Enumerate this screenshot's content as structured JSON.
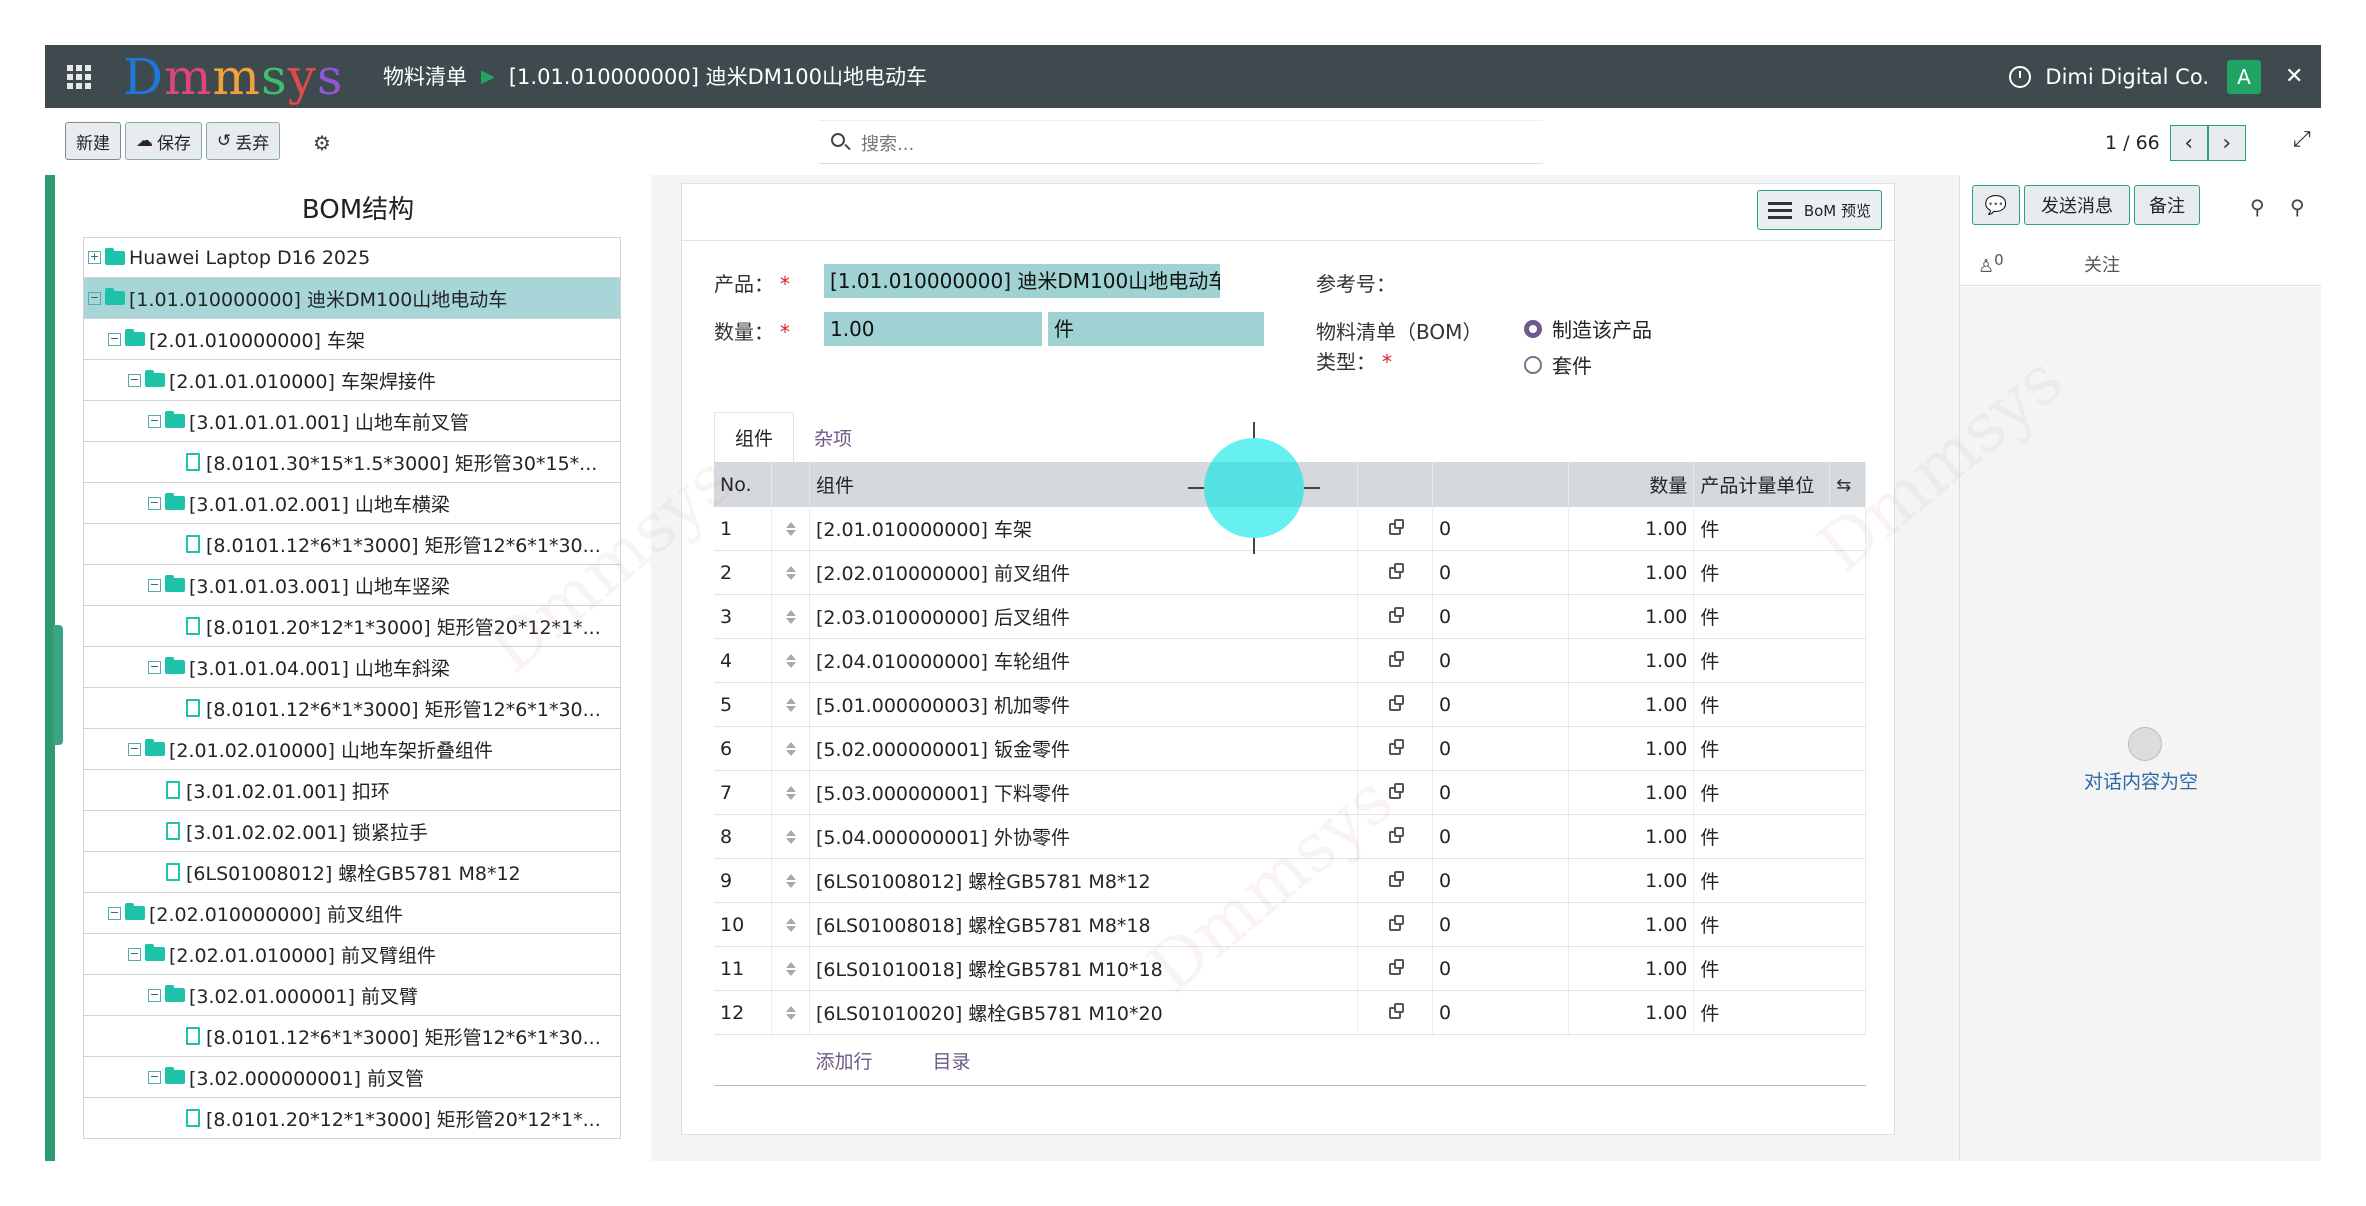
{
  "topbar": {
    "logo": "Dmmsys",
    "breadcrumb_root": "物料清单",
    "breadcrumb_current": "[1.01.010000000] 迪米DM100山地电动车",
    "company": "Dimi Digital Co.",
    "avatar_letter": "A"
  },
  "toolbar": {
    "new_label": "新建",
    "save_label": "保存",
    "discard_label": "丢弃",
    "search_placeholder": "搜索...",
    "pager": "1 / 66"
  },
  "tree": {
    "title": "BOM结构",
    "nodes": [
      {
        "label": "Huawei Laptop D16 2025",
        "level": 0,
        "kind": "folder",
        "toggle": "+",
        "selected": false
      },
      {
        "label": "[1.01.010000000] 迪米DM100山地电动车",
        "level": 0,
        "kind": "folder",
        "toggle": "-",
        "selected": true
      },
      {
        "label": "[2.01.010000000] 车架",
        "level": 1,
        "kind": "folder",
        "toggle": "-",
        "selected": false
      },
      {
        "label": "[2.01.01.010000] 车架焊接件",
        "level": 2,
        "kind": "folder",
        "toggle": "-",
        "selected": false
      },
      {
        "label": "[3.01.01.01.001] 山地车前叉管",
        "level": 3,
        "kind": "folder",
        "toggle": "-",
        "selected": false
      },
      {
        "label": "[8.0101.30*15*1.5*3000] 矩形管30*15*...",
        "level": 4,
        "kind": "file",
        "toggle": "",
        "selected": false
      },
      {
        "label": "[3.01.01.02.001] 山地车横梁",
        "level": 3,
        "kind": "folder",
        "toggle": "-",
        "selected": false
      },
      {
        "label": "[8.0101.12*6*1*3000] 矩形管12*6*1*30...",
        "level": 4,
        "kind": "file",
        "toggle": "",
        "selected": false
      },
      {
        "label": "[3.01.01.03.001] 山地车竖梁",
        "level": 3,
        "kind": "folder",
        "toggle": "-",
        "selected": false
      },
      {
        "label": "[8.0101.20*12*1*3000] 矩形管20*12*1*...",
        "level": 4,
        "kind": "file",
        "toggle": "",
        "selected": false
      },
      {
        "label": "[3.01.01.04.001] 山地车斜梁",
        "level": 3,
        "kind": "folder",
        "toggle": "-",
        "selected": false
      },
      {
        "label": "[8.0101.12*6*1*3000] 矩形管12*6*1*30...",
        "level": 4,
        "kind": "file",
        "toggle": "",
        "selected": false
      },
      {
        "label": "[2.01.02.010000] 山地车架折叠组件",
        "level": 2,
        "kind": "folder",
        "toggle": "-",
        "selected": false
      },
      {
        "label": "[3.01.02.01.001] 扣环",
        "level": 3,
        "kind": "file",
        "toggle": "",
        "selected": false
      },
      {
        "label": "[3.01.02.02.001] 锁紧拉手",
        "level": 3,
        "kind": "file",
        "toggle": "",
        "selected": false
      },
      {
        "label": "[6LS01008012] 螺栓GB5781 M8*12",
        "level": 3,
        "kind": "file",
        "toggle": "",
        "selected": false
      },
      {
        "label": "[2.02.010000000] 前叉组件",
        "level": 1,
        "kind": "folder",
        "toggle": "-",
        "selected": false
      },
      {
        "label": "[2.02.01.010000] 前叉臂组件",
        "level": 2,
        "kind": "folder",
        "toggle": "-",
        "selected": false
      },
      {
        "label": "[3.02.01.000001] 前叉臂",
        "level": 3,
        "kind": "folder",
        "toggle": "-",
        "selected": false
      },
      {
        "label": "[8.0101.12*6*1*3000] 矩形管12*6*1*30...",
        "level": 4,
        "kind": "file",
        "toggle": "",
        "selected": false
      },
      {
        "label": "[3.02.000000001] 前叉管",
        "level": 3,
        "kind": "folder",
        "toggle": "-",
        "selected": false
      },
      {
        "label": "[8.0101.20*12*1*3000] 矩形管20*12*1*...",
        "level": 4,
        "kind": "file",
        "toggle": "",
        "selected": false
      }
    ]
  },
  "form": {
    "bom_preview_label": "BoM 预览",
    "product_label": "产品：",
    "product_value": "[1.01.010000000] 迪米DM100山地电动车",
    "qty_label": "数量：",
    "qty_value": "1.00",
    "uom_value": "件",
    "ref_label": "参考号：",
    "bom_type_label_1": "物料清单（BOM）",
    "bom_type_label_2": "类型：",
    "radio_manufacture": "制造该产品",
    "radio_kit": "套件",
    "tabs": [
      "组件",
      "杂项"
    ],
    "columns": {
      "no": "No.",
      "component": "组件",
      "qty": "数量",
      "uom": "产品计量单位"
    },
    "rows": [
      {
        "no": "1",
        "component": "[2.01.010000000] 车架",
        "extra": "0",
        "qty": "1.00",
        "uom": "件"
      },
      {
        "no": "2",
        "component": "[2.02.010000000] 前叉组件",
        "extra": "0",
        "qty": "1.00",
        "uom": "件"
      },
      {
        "no": "3",
        "component": "[2.03.010000000] 后叉组件",
        "extra": "0",
        "qty": "1.00",
        "uom": "件"
      },
      {
        "no": "4",
        "component": "[2.04.010000000] 车轮组件",
        "extra": "0",
        "qty": "1.00",
        "uom": "件"
      },
      {
        "no": "5",
        "component": "[5.01.000000003] 机加零件",
        "extra": "0",
        "qty": "1.00",
        "uom": "件"
      },
      {
        "no": "6",
        "component": "[5.02.000000001] 钣金零件",
        "extra": "0",
        "qty": "1.00",
        "uom": "件"
      },
      {
        "no": "7",
        "component": "[5.03.000000001] 下料零件",
        "extra": "0",
        "qty": "1.00",
        "uom": "件"
      },
      {
        "no": "8",
        "component": "[5.04.000000001] 外协零件",
        "extra": "0",
        "qty": "1.00",
        "uom": "件"
      },
      {
        "no": "9",
        "component": "[6LS01008012] 螺栓GB5781 M8*12",
        "extra": "0",
        "qty": "1.00",
        "uom": "件"
      },
      {
        "no": "10",
        "component": "[6LS01008018] 螺栓GB5781 M8*18",
        "extra": "0",
        "qty": "1.00",
        "uom": "件"
      },
      {
        "no": "11",
        "component": "[6LS01010018] 螺栓GB5781 M10*18",
        "extra": "0",
        "qty": "1.00",
        "uom": "件"
      },
      {
        "no": "12",
        "component": "[6LS01010020] 螺栓GB5781 M10*20",
        "extra": "0",
        "qty": "1.00",
        "uom": "件"
      }
    ],
    "add_line_label": "添加行",
    "catalog_label": "目录"
  },
  "chatter": {
    "send_message_label": "发送消息",
    "note_label": "备注",
    "follower_count": "0",
    "follow_label": "关注",
    "empty_label": "对话内容为空"
  },
  "colors": {
    "topbar": "#3f4a4f",
    "accent": "#28a08a",
    "selected": "#a8d5d8",
    "link": "#6c5a88"
  }
}
